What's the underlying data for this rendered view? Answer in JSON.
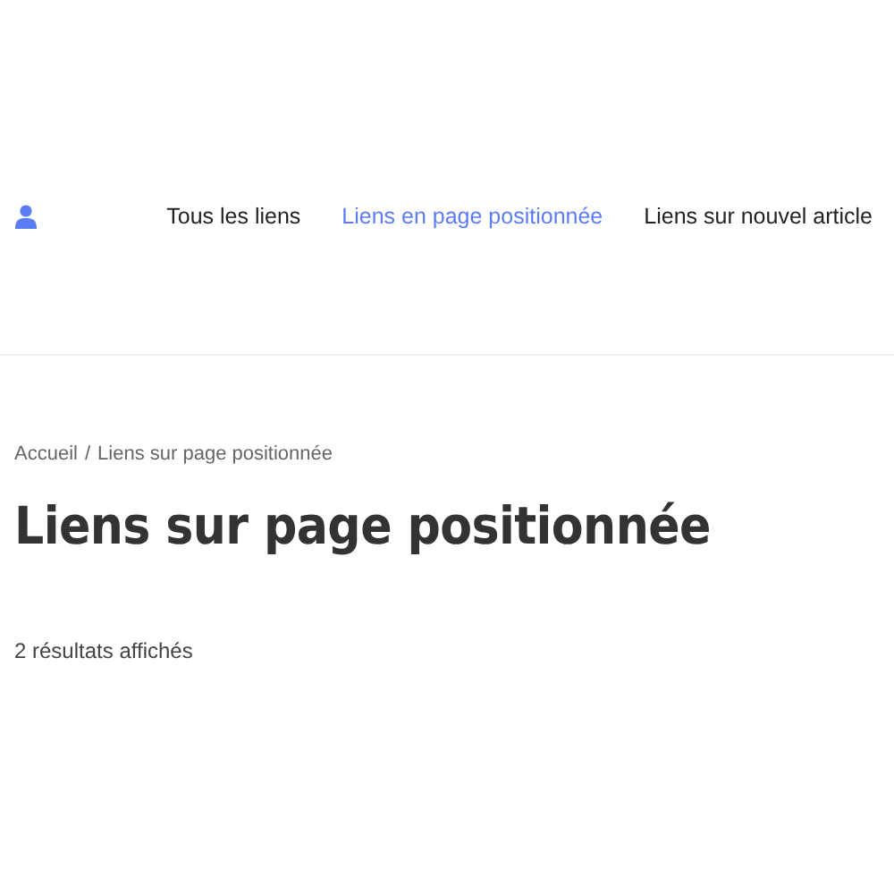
{
  "nav": {
    "items": [
      {
        "label": "Tous les liens",
        "selected": false
      },
      {
        "label": "Liens en page positionnée",
        "selected": true
      },
      {
        "label": "Liens sur nouvel article",
        "selected": false
      }
    ]
  },
  "breadcrumb": {
    "home": "Accueil",
    "separator": "/",
    "current": "Liens sur page positionnée"
  },
  "title": "Liens sur page positionnée",
  "result_count": "2 résultats affichés"
}
